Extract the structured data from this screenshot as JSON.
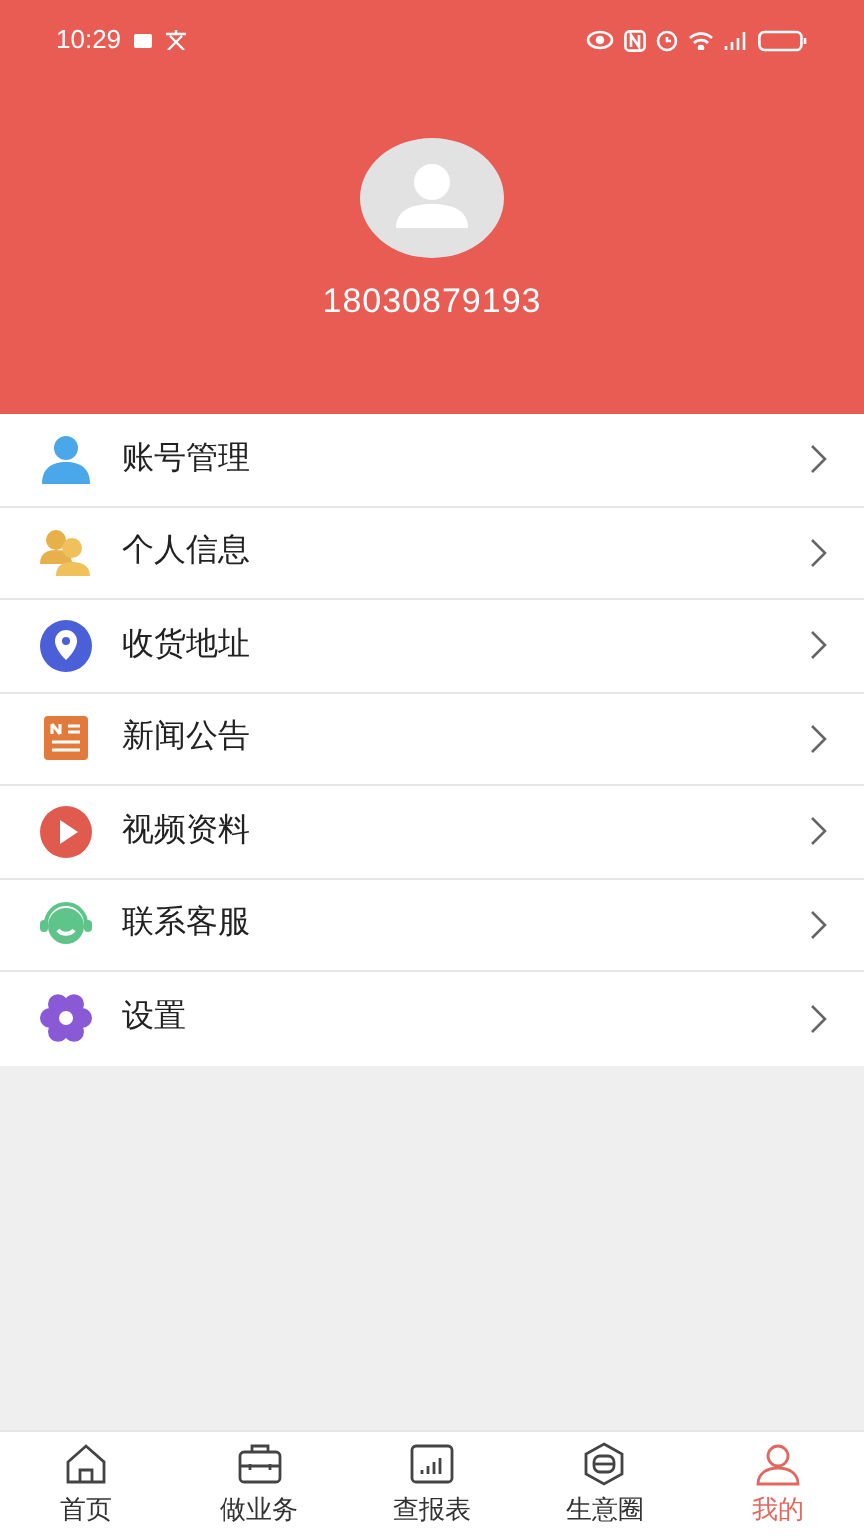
{
  "status_bar": {
    "time": "10:29"
  },
  "profile": {
    "phone": "18030879193"
  },
  "menu": [
    {
      "kind": "account",
      "label": "账号管理"
    },
    {
      "kind": "people",
      "label": "个人信息"
    },
    {
      "kind": "location",
      "label": "收货地址"
    },
    {
      "kind": "news",
      "label": "新闻公告"
    },
    {
      "kind": "video",
      "label": "视频资料"
    },
    {
      "kind": "service",
      "label": "联系客服"
    },
    {
      "kind": "settings",
      "label": "设置"
    }
  ],
  "tab_bar": [
    {
      "kind": "home",
      "label": "首页",
      "selected": false
    },
    {
      "kind": "business",
      "label": "做业务",
      "selected": false
    },
    {
      "kind": "report",
      "label": "查报表",
      "selected": false
    },
    {
      "kind": "circle",
      "label": "生意圈",
      "selected": false
    },
    {
      "kind": "mine",
      "label": "我的",
      "selected": true
    }
  ]
}
